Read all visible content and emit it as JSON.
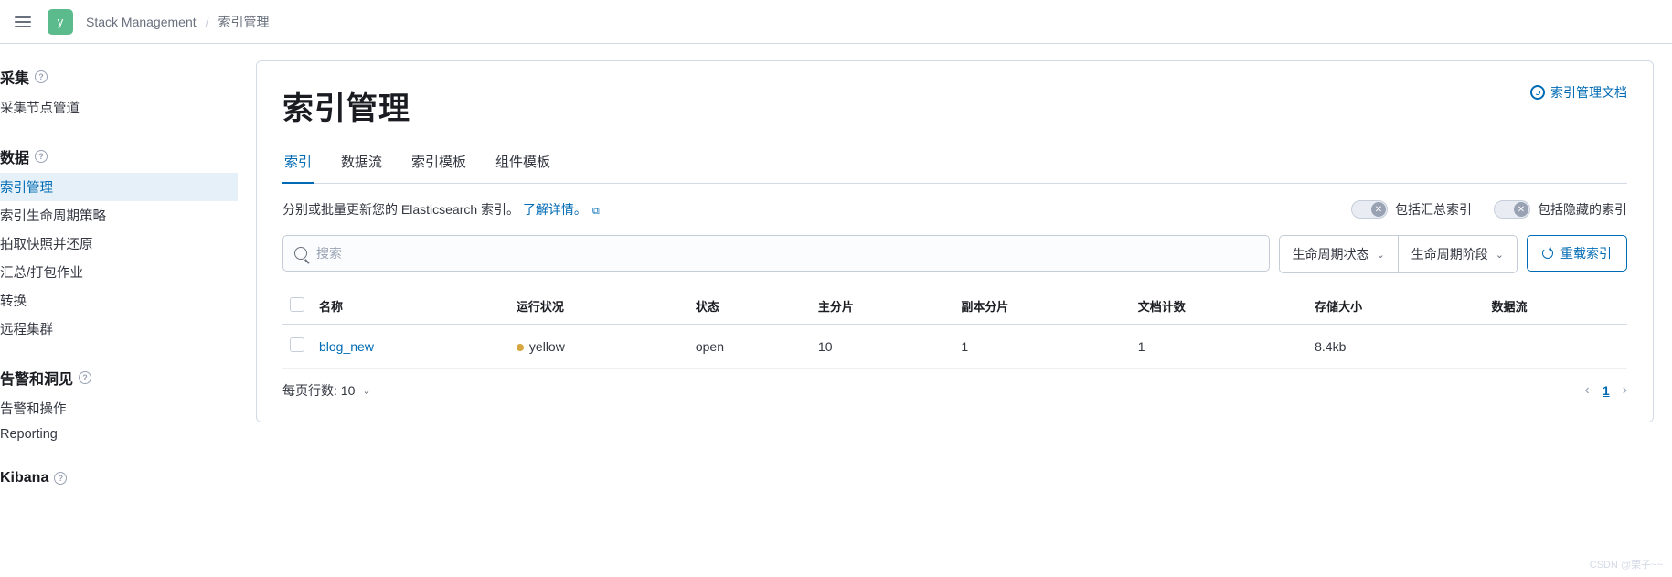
{
  "topbar": {
    "logo_letter": "y",
    "breadcrumb1": "Stack Management",
    "breadcrumb2": "索引管理"
  },
  "sidebar": {
    "sections": [
      {
        "heading": "采集",
        "items": [
          "采集节点管道"
        ]
      },
      {
        "heading": "数据",
        "items": [
          "索引管理",
          "索引生命周期策略",
          "拍取快照并还原",
          "汇总/打包作业",
          "转换",
          "远程集群"
        ],
        "active_index": 0
      },
      {
        "heading": "告警和洞见",
        "items": [
          "告警和操作",
          "Reporting"
        ]
      },
      {
        "heading": "Kibana",
        "items": []
      }
    ]
  },
  "panel": {
    "title": "索引管理",
    "docs_link": "索引管理文档",
    "tabs": [
      "索引",
      "数据流",
      "索引模板",
      "组件模板"
    ],
    "active_tab": 0,
    "desc_prefix": "分别或批量更新您的 Elasticsearch 索引。",
    "desc_link": "了解详情。",
    "toggle1": "包括汇总索引",
    "toggle2": "包括隐藏的索引",
    "search_placeholder": "搜索",
    "filter1": "生命周期状态",
    "filter2": "生命周期阶段",
    "reload": "重载索引"
  },
  "table": {
    "columns": [
      "名称",
      "运行状况",
      "状态",
      "主分片",
      "副本分片",
      "文档计数",
      "存储大小",
      "数据流"
    ],
    "rows": [
      {
        "name": "blog_new",
        "health": "yellow",
        "status": "open",
        "primary": "10",
        "replica": "1",
        "docs": "1",
        "size": "8.4kb",
        "stream": ""
      }
    ]
  },
  "pager": {
    "rows_label": "每页行数: 10",
    "current_page": "1"
  },
  "watermark": "CSDN @栗子~~"
}
